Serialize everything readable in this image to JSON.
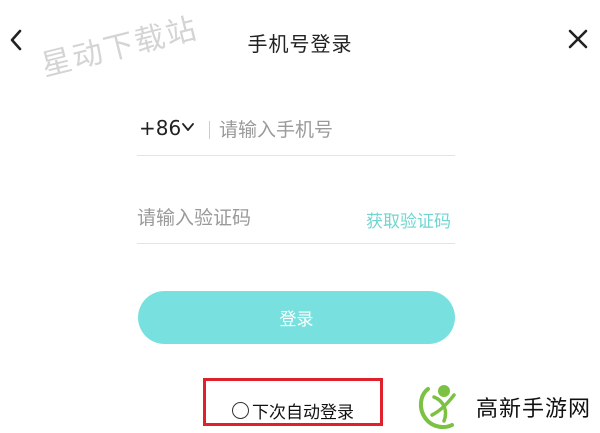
{
  "header": {
    "title": "手机号登录",
    "back_icon": "chevron-left-icon",
    "close_icon": "close-icon"
  },
  "watermark": "星动下载站",
  "form": {
    "country_code": "+86",
    "phone_placeholder": "请输入手机号",
    "code_placeholder": "请输入验证码",
    "get_code_label": "获取验证码",
    "login_label": "登录"
  },
  "remember": {
    "label": "下次自动登录",
    "checked": false
  },
  "logo": {
    "text": "高新手游网"
  },
  "colors": {
    "accent": "#78e1df",
    "link": "#6fd6d0",
    "highlight": "#e0212b",
    "logo_green": "#7bc142"
  }
}
